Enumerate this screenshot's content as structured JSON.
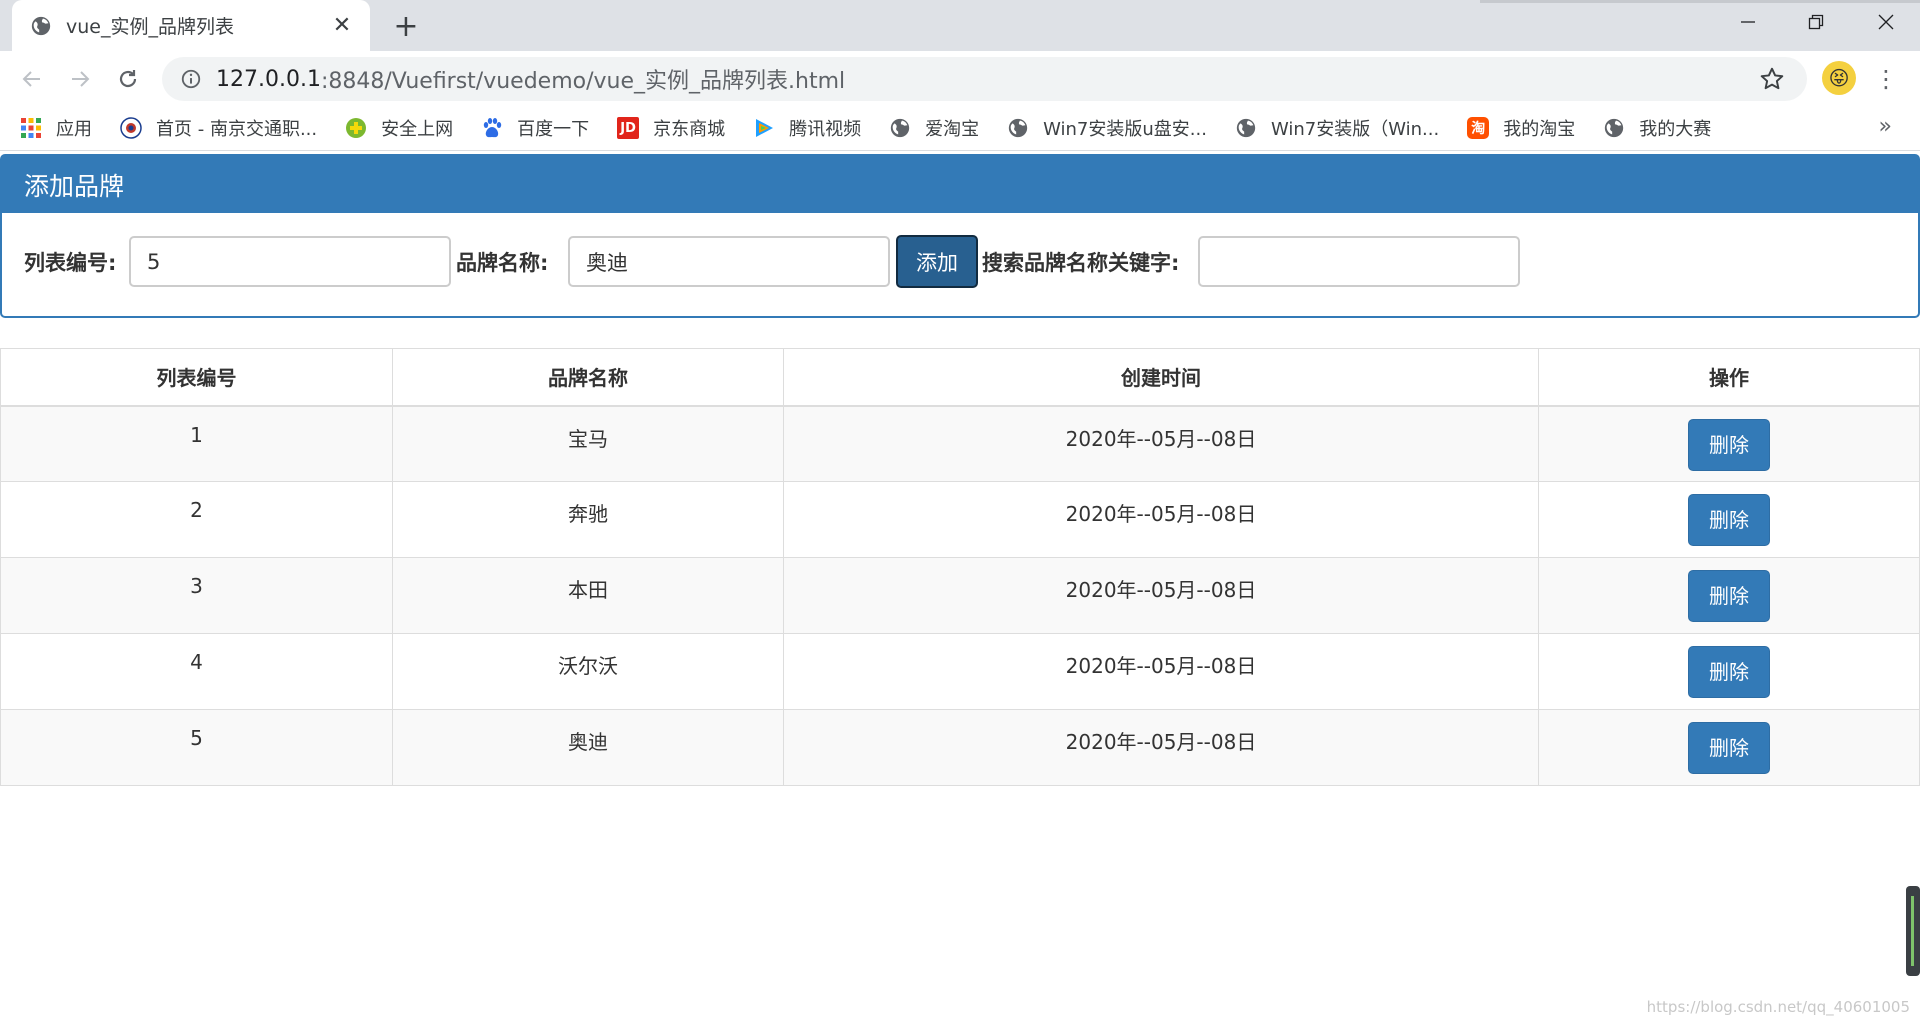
{
  "browser": {
    "tab_title": "vue_实例_品牌列表",
    "url_host": "127.0.0.1",
    "url_rest": ":8848/Vuefirst/vuedemo/vue_实例_品牌列表.html",
    "bookmarks": [
      {
        "label": "应用",
        "icon": "apps-grid-icon"
      },
      {
        "label": "首页 - 南京交通职...",
        "icon": "school-logo-icon"
      },
      {
        "label": "安全上网",
        "icon": "security-plus-icon"
      },
      {
        "label": "百度一下",
        "icon": "baidu-paw-icon"
      },
      {
        "label": "京东商城",
        "icon": "jd-logo-icon",
        "text": "JD"
      },
      {
        "label": "腾讯视频",
        "icon": "tencent-video-play-icon"
      },
      {
        "label": "爱淘宝",
        "icon": "globe-icon"
      },
      {
        "label": "Win7安装版u盘安...",
        "icon": "globe-icon"
      },
      {
        "label": "Win7安装版（Win...",
        "icon": "globe-icon"
      },
      {
        "label": "我的淘宝",
        "icon": "taobao-logo-icon",
        "text": "淘"
      },
      {
        "label": "我的大赛",
        "icon": "globe-icon"
      }
    ],
    "more": "»"
  },
  "panel": {
    "heading": "添加品牌",
    "id_label": "列表编号:",
    "id_value": "5",
    "name_label": "品牌名称:",
    "name_value": "奥迪",
    "add_label": "添加",
    "search_label": "搜索品牌名称关键字:",
    "search_value": ""
  },
  "table": {
    "headers": [
      "列表编号",
      "品牌名称",
      "创建时间",
      "操作"
    ],
    "rows": [
      {
        "id": "1",
        "name": "宝马",
        "time": "2020年--05月--08日",
        "action": "删除"
      },
      {
        "id": "2",
        "name": "奔驰",
        "time": "2020年--05月--08日",
        "action": "删除"
      },
      {
        "id": "3",
        "name": "本田",
        "time": "2020年--05月--08日",
        "action": "删除"
      },
      {
        "id": "4",
        "name": "沃尔沃",
        "time": "2020年--05月--08日",
        "action": "删除"
      },
      {
        "id": "5",
        "name": "奥迪",
        "time": "2020年--05月--08日",
        "action": "删除"
      }
    ]
  },
  "watermark": "https://blog.csdn.net/qq_40601005",
  "colors": {
    "primary": "#337ab7",
    "primary_active": "#286090",
    "chrome_frame": "#dee1e6"
  }
}
